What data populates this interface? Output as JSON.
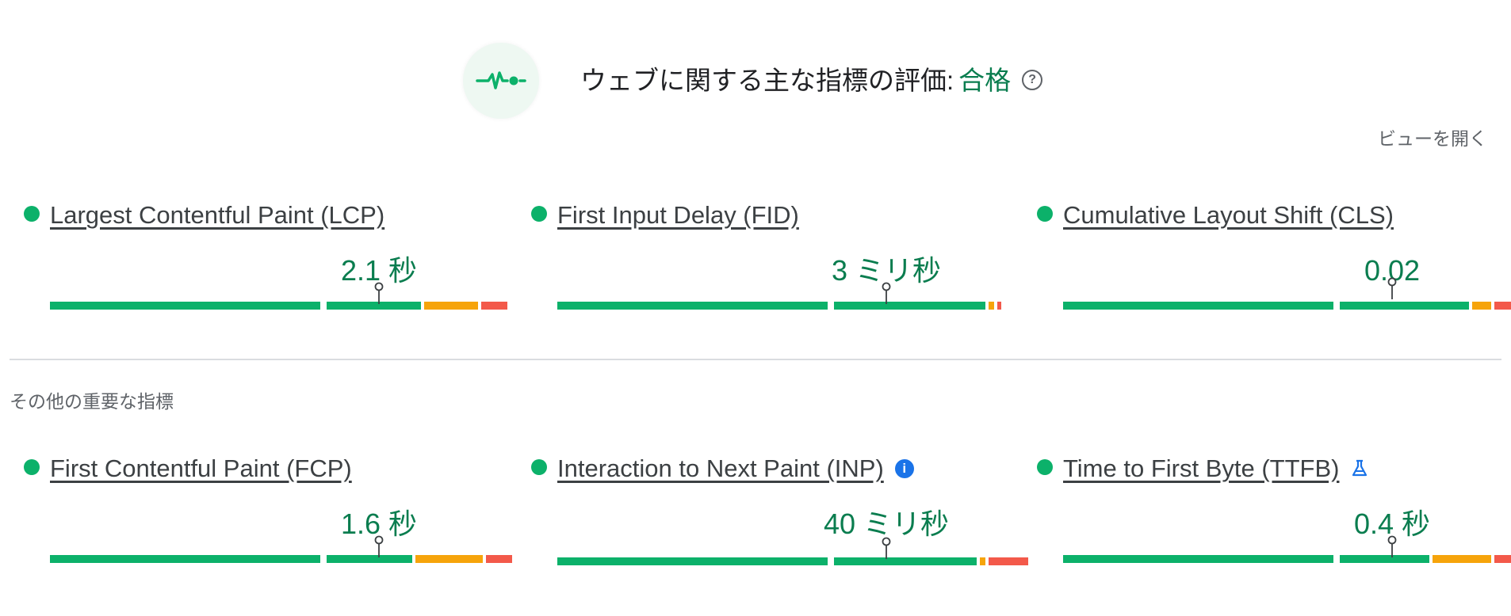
{
  "assessment": {
    "title": "ウェブに関する主な指標の評価:",
    "status": "合格",
    "help_glyph": "?",
    "expand_label": "ビューを開く",
    "icon": "pulse-icon"
  },
  "other_section_label": "その他の重要な指標",
  "colors": {
    "good": "#0cb16a",
    "needs_improvement": "#f6a40b",
    "poor": "#f3594a",
    "value_text": "#0a7d4f"
  },
  "core_metrics": [
    {
      "name": "Largest Contentful Paint (LCP)",
      "value": "2.1 秒",
      "distribution": {
        "good": 0.84,
        "needs_improvement": 0.13,
        "poor": 0.02
      },
      "p75_position": 0.75
    },
    {
      "name": "First Input Delay (FID)",
      "value": "3 ミリ秒",
      "distribution": {
        "good": 0.97,
        "needs_improvement": 0.02,
        "poor": 0.003
      },
      "p75_position": 0.75
    },
    {
      "name": "Cumulative Layout Shift (CLS)",
      "value": "0.02",
      "distribution": {
        "good": 0.92,
        "needs_improvement": 0.05,
        "poor": 0.02
      },
      "p75_position": 0.75
    }
  ],
  "other_metrics": [
    {
      "name": "First Contentful Paint (FCP)",
      "value": "1.6 秒",
      "distribution": {
        "good": 0.82,
        "needs_improvement": 0.16,
        "poor": 0.02
      },
      "p75_position": 0.75
    },
    {
      "name": "Interaction to Next Paint (INP)",
      "value": "40 ミリ秒",
      "distribution": {
        "good": 0.95,
        "needs_improvement": 0.02,
        "poor": 0.03
      },
      "p75_position": 0.75,
      "badge": "info-icon",
      "badge_glyph": "i"
    },
    {
      "name": "Time to First Byte (TTFB)",
      "value": "0.4 秒",
      "distribution": {
        "good": 0.83,
        "needs_improvement": 0.14,
        "poor": 0.02
      },
      "p75_position": 0.75,
      "badge": "experimental-flask-icon"
    }
  ]
}
